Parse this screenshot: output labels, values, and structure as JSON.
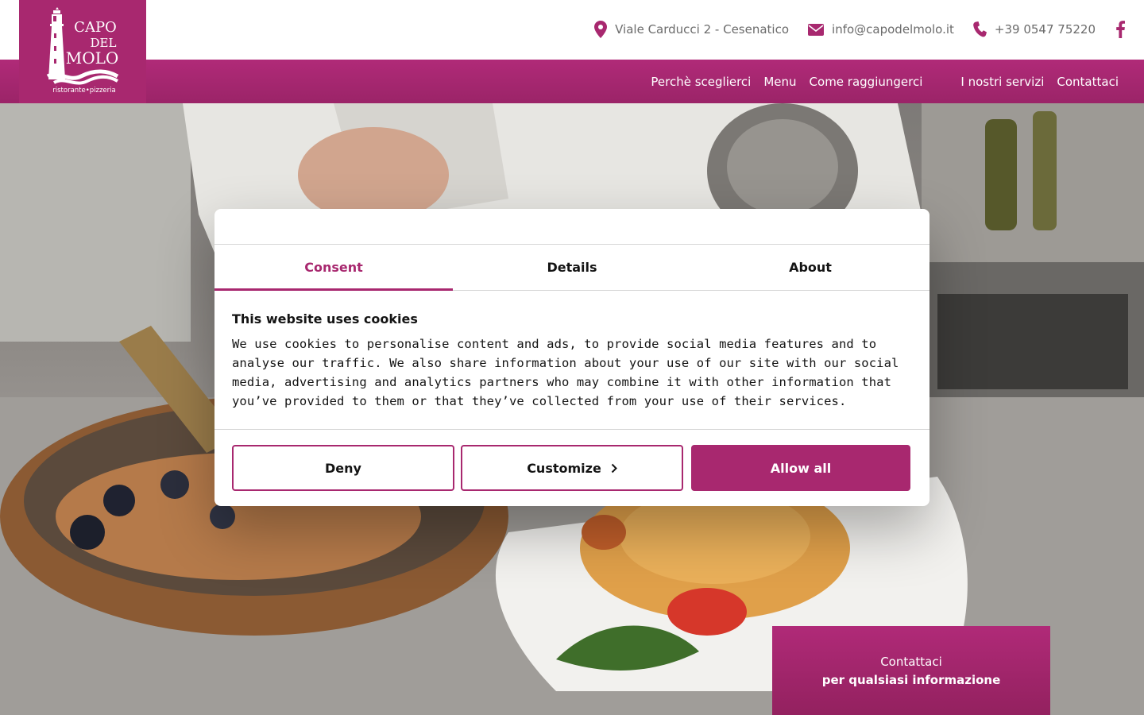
{
  "brand": {
    "name_line1": "CAPO",
    "name_line2": "DEL",
    "name_line3": "MOLO",
    "tagline": "ristorante•pizzeria",
    "color": "#a8286f"
  },
  "topbar": {
    "address": "Viale Carducci 2 - Cesenatico",
    "email": "info@capodelmolo.it",
    "phone": "+39 0547 75220",
    "icons": [
      "map-pin-icon",
      "envelope-icon",
      "phone-icon",
      "facebook-icon"
    ]
  },
  "nav": {
    "items": [
      {
        "label": "Perchè sceglierci"
      },
      {
        "label": "Menu"
      },
      {
        "label": "Come raggiungerci"
      },
      {
        "label": "I nostri servizi"
      },
      {
        "label": "Contattaci"
      }
    ]
  },
  "cookie_dialog": {
    "tabs": [
      {
        "label": "Consent",
        "active": true
      },
      {
        "label": "Details",
        "active": false
      },
      {
        "label": "About",
        "active": false
      }
    ],
    "title": "This website uses cookies",
    "text": "We use cookies to personalise content and ads, to provide social media features and to analyse our traffic. We also share information about your use of our site with our social media, advertising and analytics partners who may combine it with other information that you’ve provided to them or that they’ve collected from your use of their services.",
    "buttons": {
      "deny": "Deny",
      "customize": "Customize",
      "allow": "Allow all"
    }
  },
  "contact_box": {
    "line1": "Contattaci",
    "line2": "per qualsiasi informazione"
  }
}
